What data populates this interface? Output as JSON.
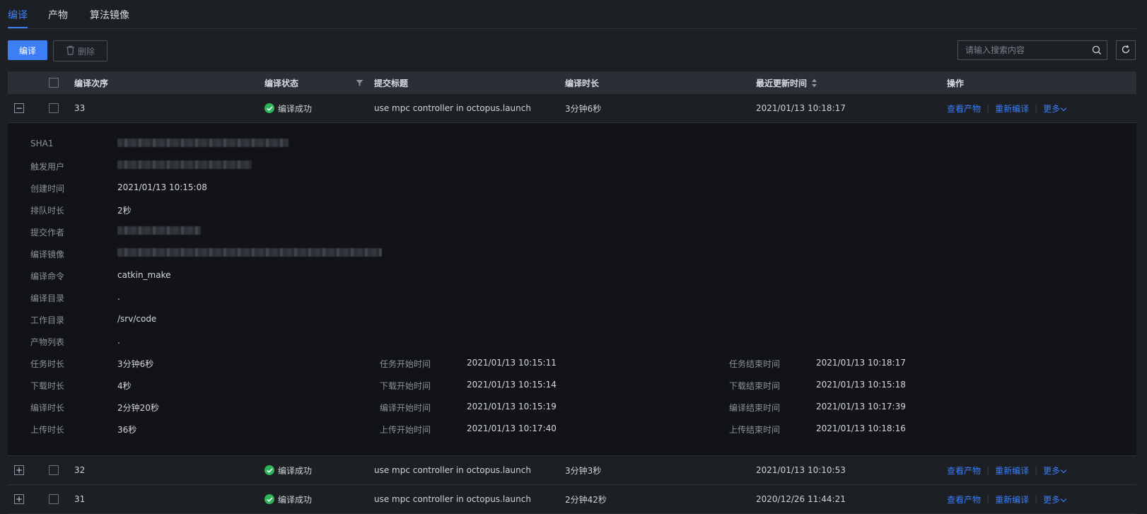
{
  "tabs": [
    {
      "label": "编译"
    },
    {
      "label": "产物"
    },
    {
      "label": "算法镜像"
    }
  ],
  "toolbar": {
    "compile_label": "编译",
    "delete_label": "删除"
  },
  "search": {
    "placeholder": "请输入搜索内容"
  },
  "columns": {
    "seq": "编译次序",
    "status": "编译状态",
    "title": "提交标题",
    "duration": "编译时长",
    "updated": "最近更新时间",
    "actions": "操作"
  },
  "rows": [
    {
      "seq": "33",
      "status": "编译成功",
      "title": "use mpc controller in octopus.launch",
      "duration": "3分钟6秒",
      "updated": "2021/01/13 10:18:17",
      "expander": "−"
    },
    {
      "seq": "32",
      "status": "编译成功",
      "title": "use mpc controller in octopus.launch",
      "duration": "3分钟3秒",
      "updated": "2021/01/13 10:10:53",
      "expander": "+"
    },
    {
      "seq": "31",
      "status": "编译成功",
      "title": "use mpc controller in octopus.launch",
      "duration": "2分钟42秒",
      "updated": "2020/12/26 11:44:21",
      "expander": "+"
    }
  ],
  "actions": {
    "view": "查看产物",
    "rebuild": "重新编译",
    "more": "更多"
  },
  "detail": {
    "sha1": {
      "label": "SHA1"
    },
    "user": {
      "label": "触发用户"
    },
    "created": {
      "label": "创建时间",
      "value": "2021/01/13 10:15:08"
    },
    "queue": {
      "label": "排队时长",
      "value": "2秒"
    },
    "author": {
      "label": "提交作者"
    },
    "image": {
      "label": "编译镜像"
    },
    "command": {
      "label": "编译命令",
      "value": "catkin_make"
    },
    "dir": {
      "label": "编译目录",
      "value": "."
    },
    "workdir": {
      "label": "工作目录",
      "value": "/srv/code"
    },
    "artifacts": {
      "label": "产物列表",
      "value": "."
    },
    "timing": [
      {
        "label": "任务时长",
        "value": "3分钟6秒",
        "start_label": "任务开始时间",
        "start": "2021/01/13 10:15:11",
        "end_label": "任务结束时间",
        "end": "2021/01/13 10:18:17"
      },
      {
        "label": "下载时长",
        "value": "4秒",
        "start_label": "下载开始时间",
        "start": "2021/01/13 10:15:14",
        "end_label": "下载结束时间",
        "end": "2021/01/13 10:15:18"
      },
      {
        "label": "编译时长",
        "value": "2分钟20秒",
        "start_label": "编译开始时间",
        "start": "2021/01/13 10:15:19",
        "end_label": "编译结束时间",
        "end": "2021/01/13 10:17:39"
      },
      {
        "label": "上传时长",
        "value": "36秒",
        "start_label": "上传开始时间",
        "start": "2021/01/13 10:17:40",
        "end_label": "上传结束时间",
        "end": "2021/01/13 10:18:16"
      }
    ]
  },
  "colors": {
    "accent": "#3d7ef7",
    "success": "#2fb45a",
    "background": "#1c1f24",
    "detail_bg": "#111316"
  }
}
